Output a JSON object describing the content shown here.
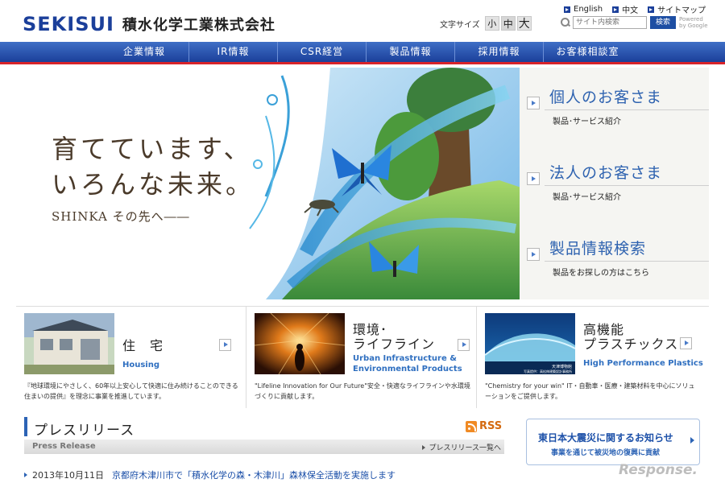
{
  "header": {
    "logo_mark": "SEKISUI",
    "company_name": "積水化学工業株式会社",
    "font_size_label": "文字サイズ",
    "font_sizes": [
      "小",
      "中",
      "大"
    ],
    "util_links": [
      "English",
      "中文",
      "サイトマップ"
    ],
    "search": {
      "placeholder": "サイト内検索",
      "button": "検索",
      "powered": "Powered by Google"
    }
  },
  "nav": [
    "企業情報",
    "IR情報",
    "CSR経営",
    "製品情報",
    "採用情報",
    "お客様相談室"
  ],
  "hero": {
    "tagline_line1": "育てています、",
    "tagline_line2": "いろんな未来。",
    "tagline_line3": "SHINKA その先へ――",
    "links": [
      {
        "title": "個人のお客さま",
        "sub": "製品･サービス紹介"
      },
      {
        "title": "法人のお客さま",
        "sub": "製品･サービス紹介"
      },
      {
        "title": "製品情報検索",
        "sub": "製品をお探しの方はこちら"
      }
    ]
  },
  "categories": [
    {
      "title_lines": [
        "住　宅"
      ],
      "en_lines": [
        "Housing"
      ],
      "desc": "『地球環境にやさしく、60年以上安心して快適に住み続けることのできる住まいの提供』を理念に事業を推進しています。"
    },
    {
      "title_lines": [
        "環境･",
        "ライフライン"
      ],
      "en_lines": [
        "Urban Infrastructure &",
        "Environmental Products"
      ],
      "desc": "\"Lifeline Innovation for Our Future\"安全・快適なライフラインや水環境づくりに貢献します。"
    },
    {
      "title_lines": [
        "高機能",
        "プラスチックス"
      ],
      "en_lines": [
        "High Performance Plastics"
      ],
      "desc": "\"Chemistry for your win\" IT・自動車・医療・建築材料を中心にソリューションをご提供します。",
      "image_caption_1": "天津博物館",
      "image_caption_2": "写真提供：高松伸建築設計事務所"
    }
  ],
  "press": {
    "title": "プレスリリース",
    "rss": "RSS",
    "subtitle_en": "Press Release",
    "all_link": "プレスリリース一覧へ",
    "items": [
      {
        "date": "2013年10月11日",
        "title": "京都府木津川市で「積水化学の森・木津川」森林保全活動を実施します"
      }
    ]
  },
  "banner": {
    "title": "東日本大震災に関するお知らせ",
    "sub": "事業を通じて被災地の復興に貢献"
  },
  "watermark": "Response."
}
